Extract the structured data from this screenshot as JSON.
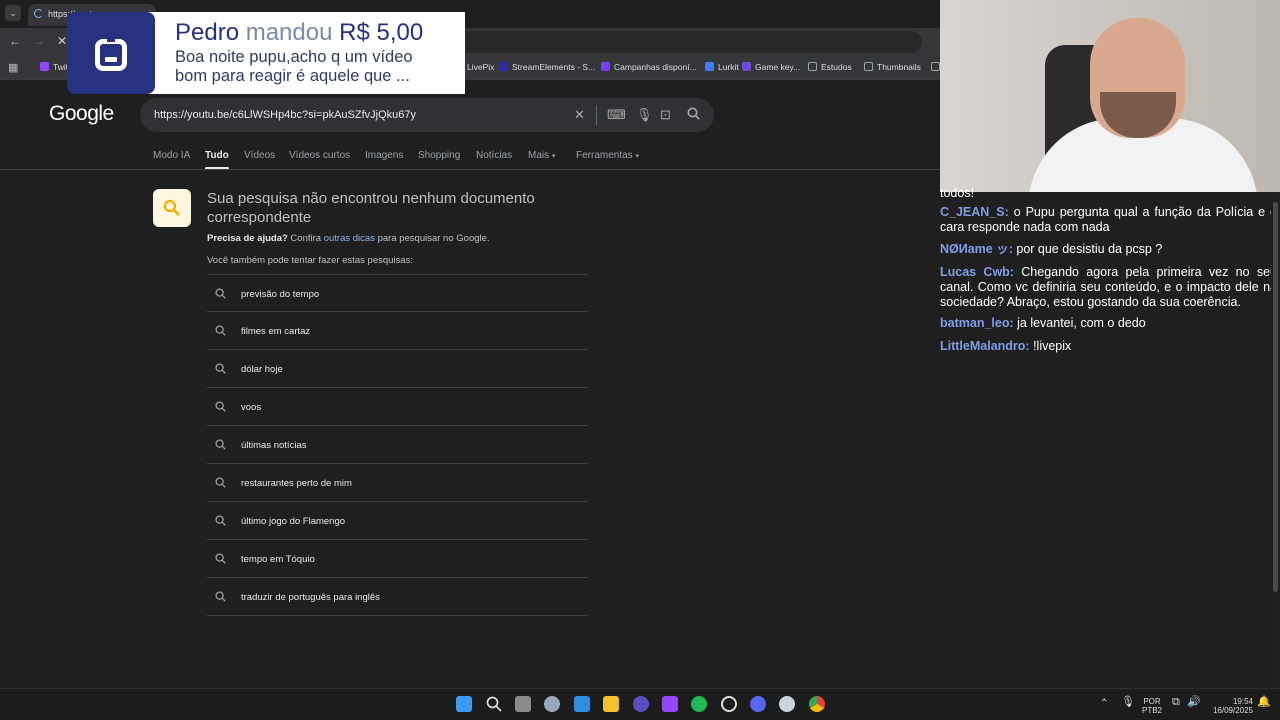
{
  "browser": {
    "tab_title": "https://yout",
    "bookmarks": [
      {
        "label": "Twit",
        "color": "#9146ff"
      },
      {
        "label": "LivePix",
        "color": "#00c16e"
      },
      {
        "label": "StreamElements - S...",
        "color": "#2a2aa8"
      },
      {
        "label": "Campanhas disponí...",
        "color": "#7d3cf8"
      },
      {
        "label": "Lurkit",
        "color": "#3d7eff"
      },
      {
        "label": "Game key...",
        "color": "#6a4dd8"
      },
      {
        "label": "Estudos",
        "color": "#9aa0a6"
      },
      {
        "label": "Thumbnails",
        "color": "#9aa0a6"
      }
    ]
  },
  "alert": {
    "name": "Pedro",
    "verb": "mandou",
    "amount": "R$ 5,00",
    "message": "Boa noite pupu,acho q um vídeo bom para reagir é aquele que ..."
  },
  "google": {
    "logo": "Google",
    "query": "https://youtu.be/c6LlWSHp4bc?si=pkAuSZfvJjQku67y",
    "tabs": [
      "Modo IA",
      "Tudo",
      "Vídeos",
      "Vídeos curtos",
      "Imagens",
      "Shopping",
      "Notícias",
      "Mais",
      "Ferramentas"
    ],
    "active_tab": "Tudo",
    "no_result_title": "Sua pesquisa não encontrou nenhum documento correspondente",
    "help_bold": "Precisa de ajuda?",
    "help_prefix": " Confira ",
    "help_link": "outras dicas",
    "help_suffix": " para pesquisar no Google.",
    "try_text": "Você também pode tentar fazer estas pesquisas:",
    "suggestions": [
      "previsão do tempo",
      "filmes em cartaz",
      "dólar hoje",
      "voos",
      "últimas notícias",
      "restaurantes perto de mim",
      "último jogo do Flamengo",
      "tempo em Tóquio",
      "traduzir de português para inglês"
    ]
  },
  "chat": {
    "partial_top": "todos!",
    "messages": [
      {
        "user": "C_JEAN_S:",
        "text": " o Pupu pergunta qual a função da Polícia e o cara responde nada com nada"
      },
      {
        "user": "NØИame ッ:",
        "text": " por que desistiu da pcsp ?"
      },
      {
        "user": "Lucas Cwb:",
        "text": " Chegando agora pela primeira vez no seu canal. Como vc definiria seu conteúdo, e o impacto dele na sociedade? Abraço, estou gostando da sua coerência."
      },
      {
        "user": "batman_leo:",
        "text": " ja levantei, com o dedo"
      },
      {
        "user": "LittleMalandro:",
        "text": " !livepix"
      }
    ]
  },
  "taskbar": {
    "lang_top": "POR",
    "lang_bottom": "PTB2",
    "time": "19:54",
    "date": "16/09/2025",
    "icons": [
      {
        "name": "windows",
        "color": "#3b9bf0"
      },
      {
        "name": "search",
        "color": "#dddddd"
      },
      {
        "name": "task-view",
        "color": "#bbbbbb"
      },
      {
        "name": "settings",
        "color": "#9aa7b8"
      },
      {
        "name": "photos",
        "color": "#2d8ee0"
      },
      {
        "name": "file-explorer",
        "color": "#f2c12e"
      },
      {
        "name": "app-purple",
        "color": "#5b4fbf"
      },
      {
        "name": "app-green",
        "color": "#9146ff"
      },
      {
        "name": "spotify",
        "color": "#1db954"
      },
      {
        "name": "obs",
        "color": "#dddddd"
      },
      {
        "name": "discord",
        "color": "#5865f2"
      },
      {
        "name": "steam",
        "color": "#c7d5e0"
      },
      {
        "name": "chrome",
        "color": "#e94235"
      }
    ]
  }
}
